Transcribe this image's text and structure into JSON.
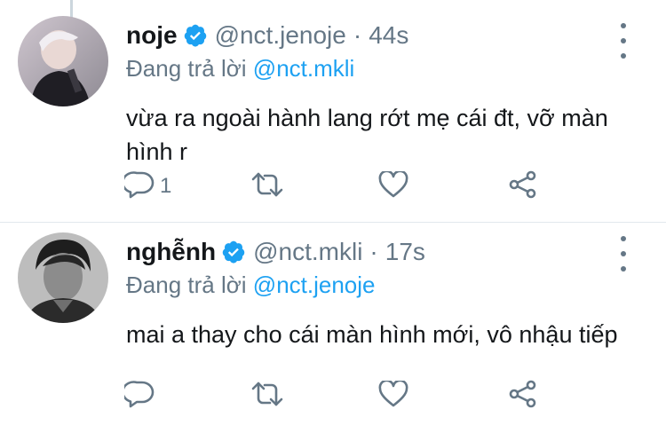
{
  "tweets": [
    {
      "display_name": "noje",
      "handle": "@nct.jenoje",
      "separator": "·",
      "time": "44s",
      "reply_prefix": "Đang trả lời",
      "reply_to": "@nct.mkli",
      "text": "vừa ra ngoài hành lang rớt mẹ cái đt, vỡ màn hình r",
      "reply_count": "1",
      "icons": [
        "reply-icon",
        "retweet-icon",
        "like-icon",
        "share-icon",
        "more-options-icon",
        "verified-badge-icon"
      ]
    },
    {
      "display_name": "nghễnh",
      "handle": "@nct.mkli",
      "separator": "·",
      "time": "17s",
      "reply_prefix": "Đang trả lời",
      "reply_to": "@nct.jenoje",
      "text": "mai a thay cho cái màn hình mới, vô nhậu tiếp",
      "reply_count": "",
      "icons": [
        "reply-icon",
        "retweet-icon",
        "like-icon",
        "share-icon",
        "more-options-icon",
        "verified-badge-icon"
      ]
    }
  ],
  "colors": {
    "accent": "#1da1f2",
    "secondary_text": "#657786",
    "primary_text": "#14171a"
  }
}
